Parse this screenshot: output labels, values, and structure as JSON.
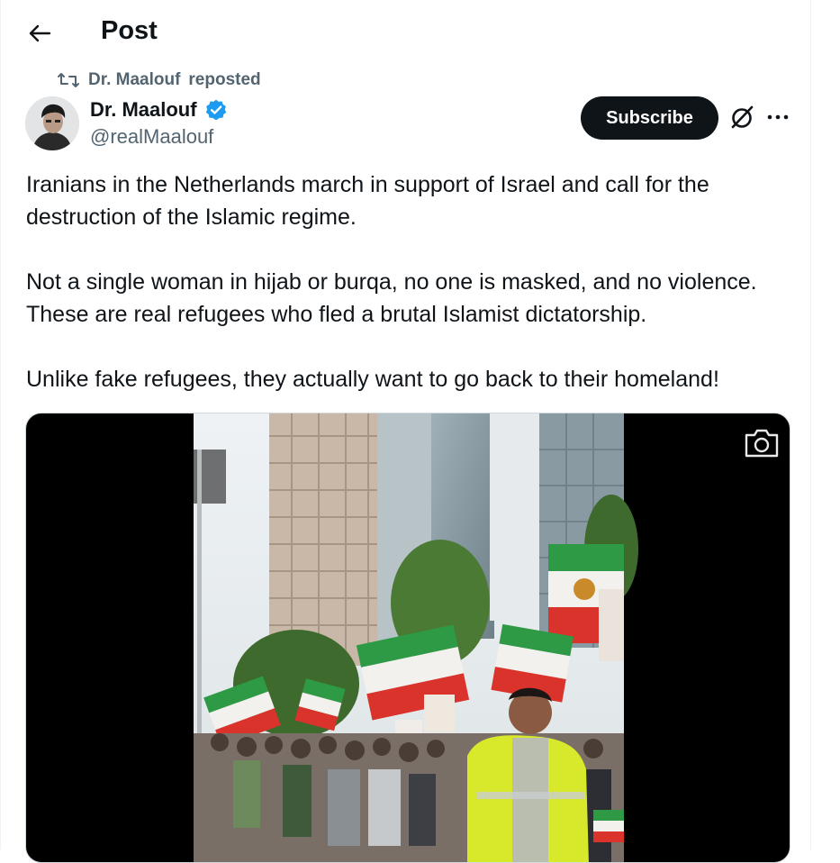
{
  "header": {
    "title": "Post",
    "back_icon": "arrow-left-icon"
  },
  "repost": {
    "icon": "repost-icon",
    "reposter": "Dr. Maalouf",
    "label": "reposted"
  },
  "author": {
    "name": "Dr. Maalouf",
    "handle": "@realMaalouf",
    "verified": true,
    "verified_color": "#1d9bf0"
  },
  "actions": {
    "subscribe_label": "Subscribe",
    "grok_icon": "grok-icon",
    "more_icon": "more-dots-icon"
  },
  "post": {
    "paragraphs": [
      "Iranians in the Netherlands march in support of Israel and call for the destruction of the Islamic regime.",
      "Not a single woman in hijab or burqa, no one is masked, and no violence. These are real refugees who fled a brutal Islamist dictatorship.",
      "Unlike fake refugees, they actually want to go back to their homeland!"
    ]
  },
  "media": {
    "type": "video",
    "icon": "camera-icon"
  },
  "colors": {
    "text": "#0f1419",
    "secondary": "#536471",
    "accent": "#1d9bf0",
    "button_bg": "#0f1419"
  }
}
